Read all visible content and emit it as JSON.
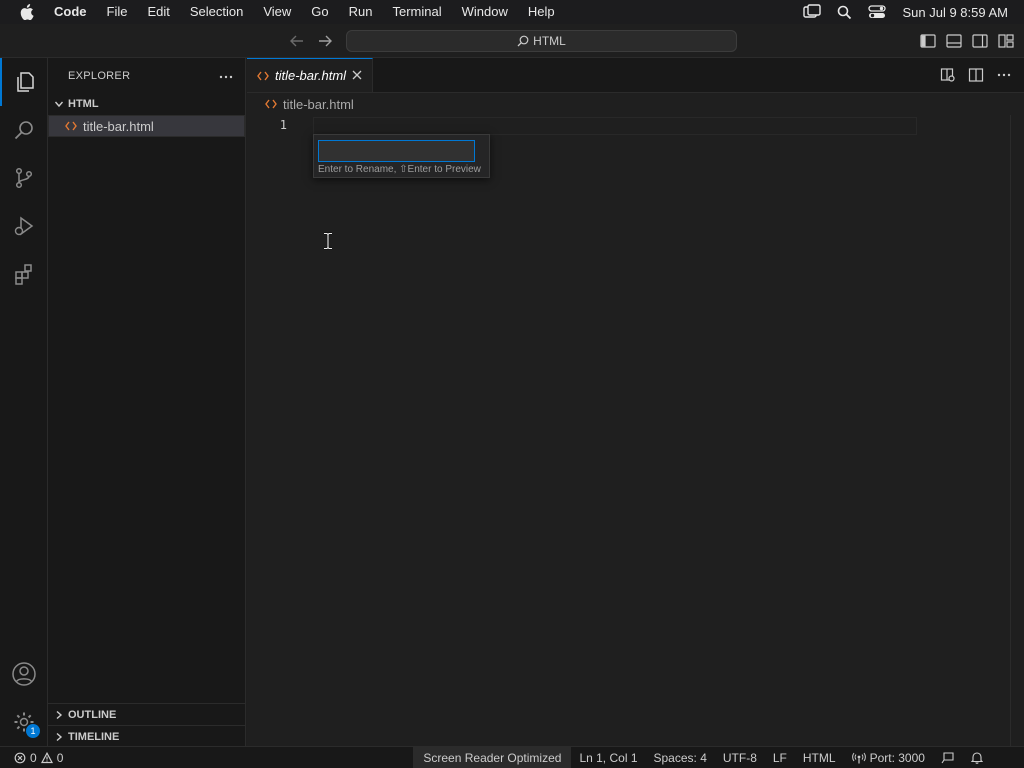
{
  "menubar": {
    "app_name": "Code",
    "items": [
      "File",
      "Edit",
      "Selection",
      "View",
      "Go",
      "Run",
      "Terminal",
      "Window",
      "Help"
    ],
    "clock": "Sun Jul 9  8:59 AM"
  },
  "titlebar": {
    "search_text": "HTML"
  },
  "sidebar": {
    "title": "EXPLORER",
    "folder_name": "HTML",
    "file_name": "title-bar.html",
    "outline_label": "OUTLINE",
    "timeline_label": "TIMELINE"
  },
  "editor": {
    "tab_label": "title-bar.html",
    "breadcrumb_file": "title-bar.html",
    "line_number": "1"
  },
  "rename_widget": {
    "value": "",
    "hint": "Enter to Rename, ⇧Enter to Preview"
  },
  "activitybar": {
    "settings_badge": "1"
  },
  "statusbar": {
    "errors": "0",
    "warnings": "0",
    "screen_reader": "Screen Reader Optimized",
    "position": "Ln 1, Col 1",
    "spaces": "Spaces: 4",
    "encoding": "UTF-8",
    "eol": "LF",
    "language": "HTML",
    "port": "Port: 3000"
  },
  "colors": {
    "accent": "#0078d4",
    "html_icon": "#e37933"
  }
}
